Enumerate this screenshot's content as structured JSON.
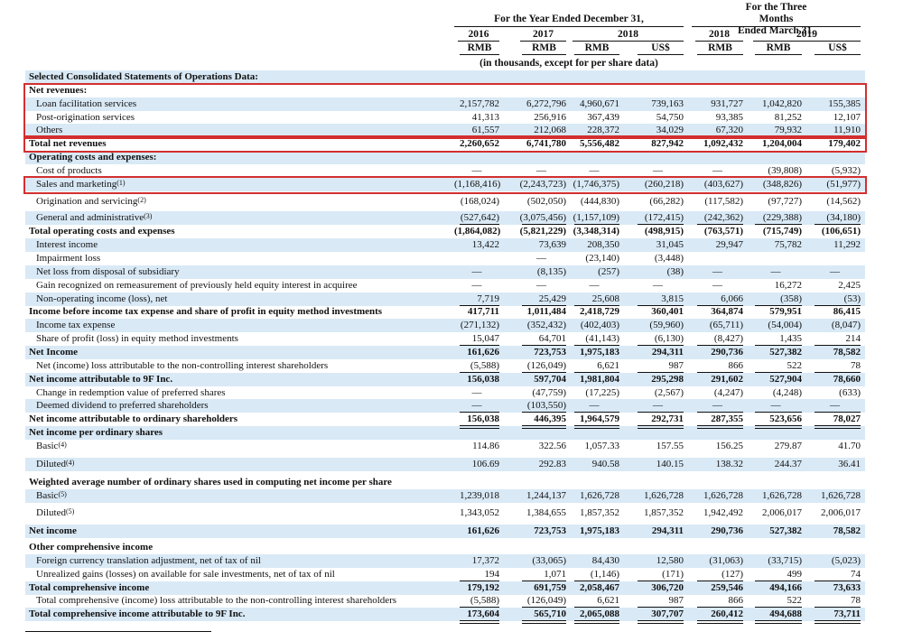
{
  "header": {
    "year_group": "For the Year Ended December 31,",
    "three_month_group_line1": "For the Three",
    "three_month_group_line2": "Months",
    "three_month_group_line3": "Ended March 31,",
    "columns": [
      {
        "year": "2016",
        "currency": "RMB"
      },
      {
        "year": "2017",
        "currency": "RMB"
      },
      {
        "year": "2018",
        "currency": "RMB"
      },
      {
        "year": "",
        "currency": "US$"
      },
      {
        "year": "2018",
        "currency": "RMB"
      },
      {
        "year": "2019",
        "currency": "RMB"
      },
      {
        "year": "",
        "currency": "US$"
      }
    ],
    "units_note": "(in thousands, except for per share data)"
  },
  "rows": [
    {
      "label": "Selected Consolidated Statements of Operations Data:",
      "bold": true,
      "values": [
        "",
        "",
        "",
        "",
        "",
        "",
        ""
      ]
    },
    {
      "label": "Net revenues:",
      "bold": true,
      "values": [
        "",
        "",
        "",
        "",
        "",
        "",
        ""
      ]
    },
    {
      "label": "Loan facilitation services",
      "indent": true,
      "values": [
        "2,157,782",
        "6,272,796",
        "4,960,671",
        "739,163",
        "931,727",
        "1,042,820",
        "155,385"
      ]
    },
    {
      "label": "Post-origination services",
      "indent": true,
      "values": [
        "41,313",
        "256,916",
        "367,439",
        "54,750",
        "93,385",
        "81,252",
        "12,107"
      ]
    },
    {
      "label": "Others",
      "indent": true,
      "values": [
        "61,557",
        "212,068",
        "228,372",
        "34,029",
        "67,320",
        "79,932",
        "11,910"
      ]
    },
    {
      "label": "Total net revenues",
      "bold": true,
      "values": [
        "2,260,652",
        "6,741,780",
        "5,556,482",
        "827,942",
        "1,092,432",
        "1,204,004",
        "179,402"
      ]
    },
    {
      "label": "Operating costs and expenses:",
      "bold": true,
      "values": [
        "",
        "",
        "",
        "",
        "",
        "",
        ""
      ]
    },
    {
      "label": "Cost of products",
      "indent": true,
      "values": [
        "—",
        "—",
        "—",
        "—",
        "—",
        "(39,808)",
        "(5,932)"
      ]
    },
    {
      "label": "Sales and marketing",
      "sup": "(1)",
      "indent": true,
      "values": [
        "(1,168,416)",
        "(2,243,723)",
        "(1,746,375)",
        "(260,218)",
        "(403,627)",
        "(348,826)",
        "(51,977)"
      ]
    },
    {
      "label": "Origination and servicing",
      "sup": "(2)",
      "indent": true,
      "values": [
        "(168,024)",
        "(502,050)",
        "(444,830)",
        "(66,282)",
        "(117,582)",
        "(97,727)",
        "(14,562)"
      ]
    },
    {
      "label": "General and administrative",
      "sup": "(3)",
      "indent": true,
      "values": [
        "(527,642)",
        "(3,075,456)",
        "(1,157,109)",
        "(172,415)",
        "(242,362)",
        "(229,388)",
        "(34,180)"
      ]
    },
    {
      "label": "Total operating costs and expenses",
      "bold": true,
      "values": [
        "(1,864,082)",
        "(5,821,229)",
        "(3,348,314)",
        "(498,915)",
        "(763,571)",
        "(715,749)",
        "(106,651)"
      ]
    },
    {
      "label": "Interest income",
      "indent": true,
      "values": [
        "13,422",
        "73,639",
        "208,350",
        "31,045",
        "29,947",
        "75,782",
        "11,292"
      ]
    },
    {
      "label": "Impairment loss",
      "indent": true,
      "values": [
        "",
        "—",
        "(23,140)",
        "(3,448)",
        "",
        "",
        ""
      ]
    },
    {
      "label": "Net loss from disposal of subsidiary",
      "indent": true,
      "values": [
        "—",
        "(8,135)",
        "(257)",
        "(38)",
        "—",
        "—",
        "—"
      ]
    },
    {
      "label": "Gain recognized on remeasurement of previously held equity interest in acquiree",
      "indent": true,
      "values": [
        "—",
        "—",
        "—",
        "—",
        "—",
        "16,272",
        "2,425"
      ]
    },
    {
      "label": "Non-operating income (loss), net",
      "indent": true,
      "values": [
        "7,719",
        "25,429",
        "25,608",
        "3,815",
        "6,066",
        "(358)",
        "(53)"
      ]
    },
    {
      "label": "Income before income tax expense and share of profit in equity method investments",
      "bold": true,
      "values": [
        "417,711",
        "1,011,484",
        "2,418,729",
        "360,401",
        "364,874",
        "579,951",
        "86,415"
      ]
    },
    {
      "label": "Income tax expense",
      "indent": true,
      "values": [
        "(271,132)",
        "(352,432)",
        "(402,403)",
        "(59,960)",
        "(65,711)",
        "(54,004)",
        "(8,047)"
      ]
    },
    {
      "label": "Share of profit (loss) in equity method investments",
      "indent": true,
      "values": [
        "15,047",
        "64,701",
        "(41,143)",
        "(6,130)",
        "(8,427)",
        "1,435",
        "214"
      ]
    },
    {
      "label": "Net Income",
      "bold": true,
      "values": [
        "161,626",
        "723,753",
        "1,975,183",
        "294,311",
        "290,736",
        "527,382",
        "78,582"
      ]
    },
    {
      "label": "Net (income) loss attributable to the non-controlling interest shareholders",
      "indent": true,
      "values": [
        "(5,588)",
        "(126,049)",
        "6,621",
        "987",
        "866",
        "522",
        "78"
      ]
    },
    {
      "label": "Net income attributable to 9F Inc.",
      "bold": true,
      "values": [
        "156,038",
        "597,704",
        "1,981,804",
        "295,298",
        "291,602",
        "527,904",
        "78,660"
      ]
    },
    {
      "label": "Change in redemption value of preferred shares",
      "indent": true,
      "values": [
        "—",
        "(47,759)",
        "(17,225)",
        "(2,567)",
        "(4,247)",
        "(4,248)",
        "(633)"
      ]
    },
    {
      "label": "Deemed dividend to preferred shareholders",
      "indent": true,
      "values": [
        "—",
        "(103,550)",
        "—",
        "—",
        "—",
        "—",
        "—"
      ]
    },
    {
      "label": "Net income attributable to ordinary shareholders",
      "bold": true,
      "values": [
        "156,038",
        "446,395",
        "1,964,579",
        "292,731",
        "287,355",
        "523,656",
        "78,027"
      ]
    },
    {
      "label": "Net income per ordinary shares",
      "bold": true,
      "values": [
        "",
        "",
        "",
        "",
        "",
        "",
        ""
      ]
    },
    {
      "label": "Basic",
      "sup": "(4)",
      "indent": true,
      "values": [
        "114.86",
        "322.56",
        "1,057.33",
        "157.55",
        "156.25",
        "279.87",
        "41.70"
      ]
    },
    {
      "label": "Diluted",
      "sup": "(4)",
      "indent": true,
      "values": [
        "106.69",
        "292.83",
        "940.58",
        "140.15",
        "138.32",
        "244.37",
        "36.41"
      ]
    },
    {
      "label": "Weighted average number of ordinary shares used in computing net income per share",
      "bold": true,
      "values": [
        "",
        "",
        "",
        "",
        "",
        "",
        ""
      ]
    },
    {
      "label": "Basic",
      "sup": "(5)",
      "indent": true,
      "values": [
        "1,239,018",
        "1,244,137",
        "1,626,728",
        "1,626,728",
        "1,626,728",
        "1,626,728",
        "1,626,728"
      ]
    },
    {
      "label": "Diluted",
      "sup": "(5)",
      "indent": true,
      "values": [
        "1,343,052",
        "1,384,655",
        "1,857,352",
        "1,857,352",
        "1,942,492",
        "2,006,017",
        "2,006,017"
      ]
    },
    {
      "label": "Net income",
      "bold": true,
      "values": [
        "161,626",
        "723,753",
        "1,975,183",
        "294,311",
        "290,736",
        "527,382",
        "78,582"
      ]
    },
    {
      "label": "Other comprehensive income",
      "bold": true,
      "values": [
        "",
        "",
        "",
        "",
        "",
        "",
        ""
      ]
    },
    {
      "label": "Foreign currency translation adjustment, net of tax of nil",
      "indent": true,
      "values": [
        "17,372",
        "(33,065)",
        "84,430",
        "12,580",
        "(31,063)",
        "(33,715)",
        "(5,023)"
      ]
    },
    {
      "label": "Unrealized gains (losses) on available for sale investments, net of tax of nil",
      "indent": true,
      "values": [
        "194",
        "1,071",
        "(1,146)",
        "(171)",
        "(127)",
        "499",
        "74"
      ]
    },
    {
      "label": "Total comprehensive income",
      "bold": true,
      "values": [
        "179,192",
        "691,759",
        "2,058,467",
        "306,720",
        "259,546",
        "494,166",
        "73,633"
      ]
    },
    {
      "label": "Total comprehensive (income) loss attributable to the non-controlling interest shareholders",
      "indent": true,
      "values": [
        "(5,588)",
        "(126,049)",
        "6,621",
        "987",
        "866",
        "522",
        "78"
      ]
    },
    {
      "label": "Total comprehensive income attributable to 9F Inc.",
      "bold": true,
      "values": [
        "173,604",
        "565,710",
        "2,065,088",
        "307,707",
        "260,412",
        "494,688",
        "73,711"
      ]
    }
  ],
  "colors": {
    "row_tint": "#d9e9f6",
    "highlight_box": "#d32f2f"
  }
}
